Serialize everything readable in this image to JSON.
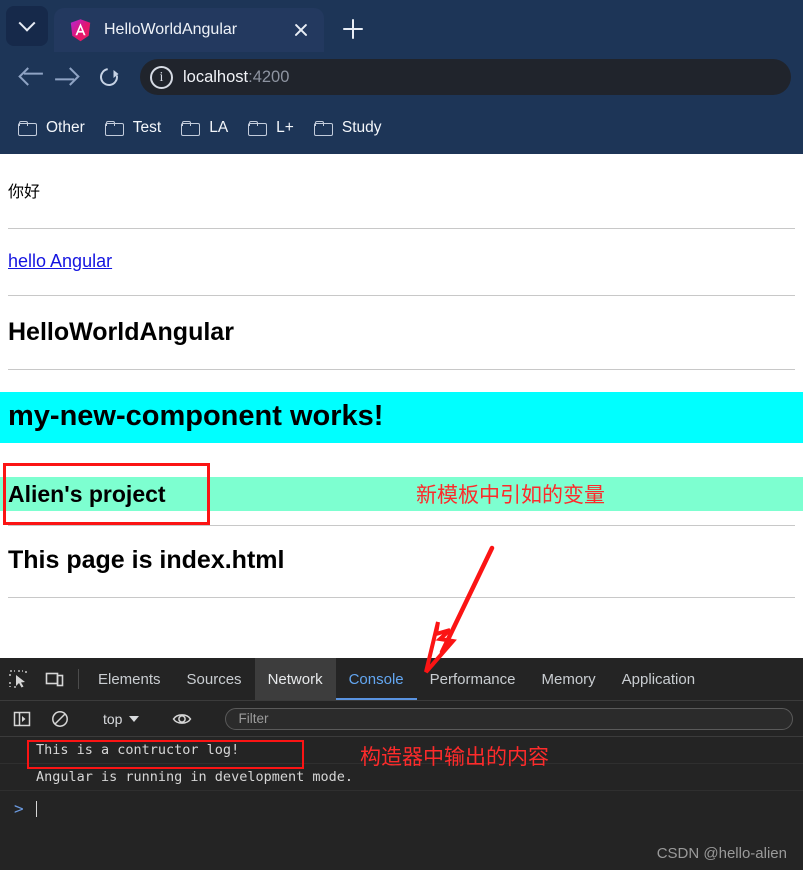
{
  "browser": {
    "tab": {
      "title": "HelloWorldAngular",
      "favicon": "angular-logo"
    },
    "tab_list_icon": "chevron-down-icon",
    "new_tab_icon": "plus-icon",
    "close_icon": "close-icon",
    "nav": {
      "back_icon": "arrow-left-icon",
      "forward_icon": "arrow-right-icon",
      "reload_icon": "reload-icon",
      "site_info_icon": "info-circle-icon",
      "url_host": "localhost",
      "url_rest": ":4200",
      "url_full": "localhost:4200"
    },
    "bookmarks": [
      {
        "label": "Other",
        "icon": "folder-icon"
      },
      {
        "label": "Test",
        "icon": "folder-icon"
      },
      {
        "label": "LA",
        "icon": "folder-icon"
      },
      {
        "label": "L+",
        "icon": "folder-icon"
      },
      {
        "label": "Study",
        "icon": "folder-icon"
      }
    ]
  },
  "page": {
    "greeting": "你好",
    "link_text": "hello Angular",
    "app_title": "HelloWorldAngular",
    "component_banner": "my-new-component works!",
    "project_name": "Alien's project",
    "annotation_variable": "新模板中引如的变量",
    "index_heading": "This page is index.html"
  },
  "devtools": {
    "icons": {
      "inspect": "inspect-element-icon",
      "device": "device-toolbar-icon",
      "sidebar": "console-sidebar-icon",
      "clear": "clear-console-icon",
      "eye": "live-expression-icon",
      "caret": "chevron-down-icon"
    },
    "tabs": [
      {
        "label": "Elements",
        "state": "normal"
      },
      {
        "label": "Sources",
        "state": "normal"
      },
      {
        "label": "Network",
        "state": "hover"
      },
      {
        "label": "Console",
        "state": "active"
      },
      {
        "label": "Performance",
        "state": "normal"
      },
      {
        "label": "Memory",
        "state": "normal"
      },
      {
        "label": "Application",
        "state": "normal"
      }
    ],
    "context_selector": "top",
    "filter_placeholder": "Filter",
    "logs": [
      "This is a contructor log!",
      "Angular is running in development mode."
    ],
    "annotation_console": "构造器中输出的内容",
    "prompt_symbol": ">"
  },
  "watermark": "CSDN @hello-alien",
  "colors": {
    "chrome": "#1d3557",
    "omnibox": "#20242c",
    "cyan_band": "#00ffff",
    "green_band": "#7dffd0",
    "annotation_red": "#fd2b2b",
    "devtools_bg": "#242424",
    "active_tab_blue": "#63a6f0",
    "link_blue": "#1414e0"
  }
}
